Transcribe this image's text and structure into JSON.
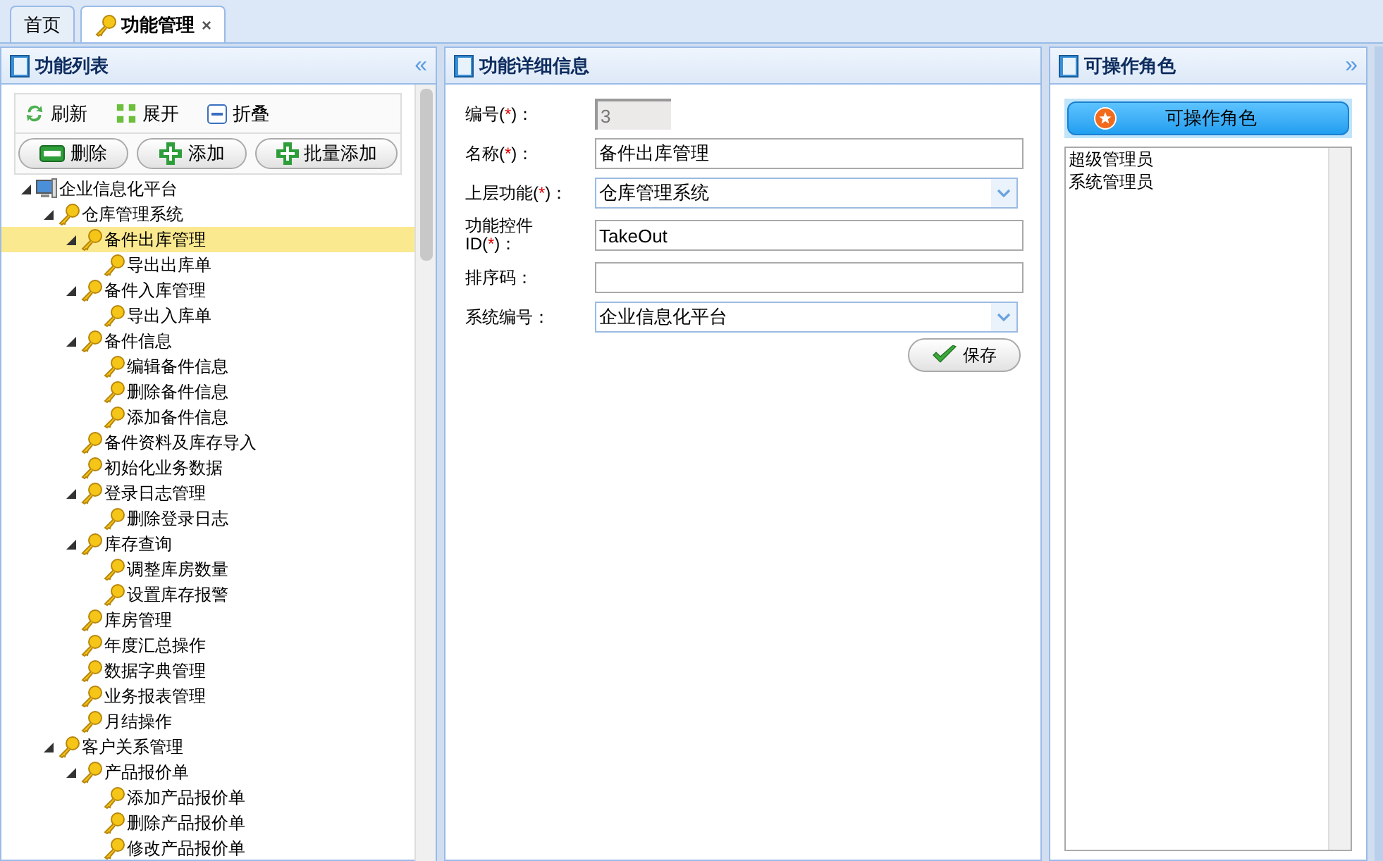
{
  "tabs": [
    {
      "label": "首页",
      "selected": false,
      "kind": "home"
    },
    {
      "label": "功能管理",
      "selected": true,
      "kind": "module",
      "close": "×"
    }
  ],
  "left_panel": {
    "title": "功能列表",
    "collapse": "«",
    "toolbar": [
      {
        "label": "刷新",
        "kind": "refresh"
      },
      {
        "label": "展开",
        "kind": "expand"
      },
      {
        "label": "折叠",
        "kind": "collapse"
      }
    ],
    "buttons": [
      {
        "label": "删除",
        "kind": "remove"
      },
      {
        "label": "添加",
        "kind": "add"
      },
      {
        "label": "批量添加",
        "kind": "add"
      }
    ],
    "tree": [
      {
        "label": "企业信息化平台",
        "kind": "computer",
        "selected": false,
        "expanded": true,
        "children": [
          {
            "label": "仓库管理系统",
            "kind": "key",
            "selected": false,
            "expanded": true,
            "children": [
              {
                "label": "备件出库管理",
                "kind": "key",
                "selected": true,
                "expanded": true,
                "children": [
                  {
                    "label": "导出出库单",
                    "kind": "key",
                    "selected": false
                  }
                ]
              },
              {
                "label": "备件入库管理",
                "kind": "key",
                "selected": false,
                "expanded": true,
                "children": [
                  {
                    "label": "导出入库单",
                    "kind": "key",
                    "selected": false
                  }
                ]
              },
              {
                "label": "备件信息",
                "kind": "key",
                "selected": false,
                "expanded": true,
                "children": [
                  {
                    "label": "编辑备件信息",
                    "kind": "key",
                    "selected": false
                  },
                  {
                    "label": "删除备件信息",
                    "kind": "key",
                    "selected": false
                  },
                  {
                    "label": "添加备件信息",
                    "kind": "key",
                    "selected": false
                  }
                ]
              },
              {
                "label": "备件资料及库存导入",
                "kind": "key",
                "selected": false
              },
              {
                "label": "初始化业务数据",
                "kind": "key",
                "selected": false
              },
              {
                "label": "登录日志管理",
                "kind": "key",
                "selected": false,
                "expanded": true,
                "children": [
                  {
                    "label": "删除登录日志",
                    "kind": "key",
                    "selected": false
                  }
                ]
              },
              {
                "label": "库存查询",
                "kind": "key",
                "selected": false,
                "expanded": true,
                "children": [
                  {
                    "label": "调整库房数量",
                    "kind": "key",
                    "selected": false
                  },
                  {
                    "label": "设置库存报警",
                    "kind": "key",
                    "selected": false
                  }
                ]
              },
              {
                "label": "库房管理",
                "kind": "key",
                "selected": false
              },
              {
                "label": "年度汇总操作",
                "kind": "key",
                "selected": false
              },
              {
                "label": "数据字典管理",
                "kind": "key",
                "selected": false
              },
              {
                "label": "业务报表管理",
                "kind": "key",
                "selected": false
              },
              {
                "label": "月结操作",
                "kind": "key",
                "selected": false
              }
            ]
          },
          {
            "label": "客户关系管理",
            "kind": "key",
            "selected": false,
            "expanded": true,
            "children": [
              {
                "label": "产品报价单",
                "kind": "key",
                "selected": false,
                "expanded": true,
                "children": [
                  {
                    "label": "添加产品报价单",
                    "kind": "key",
                    "selected": false
                  },
                  {
                    "label": "删除产品报价单",
                    "kind": "key",
                    "selected": false
                  },
                  {
                    "label": "修改产品报价单",
                    "kind": "key",
                    "selected": false
                  }
                ]
              }
            ]
          }
        ]
      }
    ]
  },
  "detail_panel": {
    "title": "功能详细信息",
    "fields": [
      {
        "label": "编号(",
        "required": "*",
        "label_end": ")：",
        "kind": "readonly",
        "value": "3"
      },
      {
        "label": "名称(",
        "required": "*",
        "label_end": ")：",
        "kind": "text",
        "value": "备件出库管理"
      },
      {
        "label": "上层功能(",
        "required": "*",
        "label_end": ")：",
        "kind": "select",
        "value": "仓库管理系统"
      },
      {
        "label": "功能控件ID(",
        "required": "*",
        "label_end": ")：",
        "kind": "text",
        "value": "TakeOut"
      },
      {
        "label": "排序码：",
        "kind": "text"
      },
      {
        "label": "系统编号：",
        "kind": "select",
        "value": "企业信息化平台"
      }
    ],
    "save": "保存"
  },
  "right_panel": {
    "title": "可操作角色",
    "expand": "»",
    "button": "可操作角色",
    "roles": [
      "超级管理员",
      "系统管理员"
    ]
  }
}
